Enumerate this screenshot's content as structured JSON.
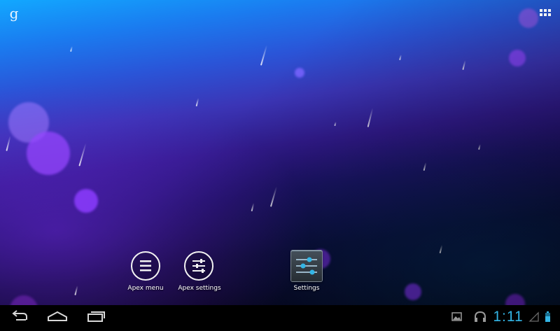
{
  "home_screen": {
    "google_search_glyph": "g",
    "shortcuts": [
      {
        "label": "Apex menu",
        "icon": "menu-lines-icon"
      },
      {
        "label": "Apex settings",
        "icon": "sliders-icon"
      },
      {
        "label": "Settings",
        "icon": "settings-sliders-icon"
      }
    ]
  },
  "status_bar": {
    "clock": "1:11",
    "clock_color": "#33b5e5",
    "notification_icons": [
      "gallery-notification-icon",
      "headphones-icon"
    ],
    "system_icons": [
      "signal-icon",
      "battery-icon"
    ]
  },
  "navigation": {
    "buttons": [
      "back-button",
      "home-button",
      "recent-apps-button"
    ]
  },
  "wallpaper": {
    "accent_colors": [
      "#12a8ff",
      "#3b35b6",
      "#7a30ff",
      "#050313"
    ]
  }
}
